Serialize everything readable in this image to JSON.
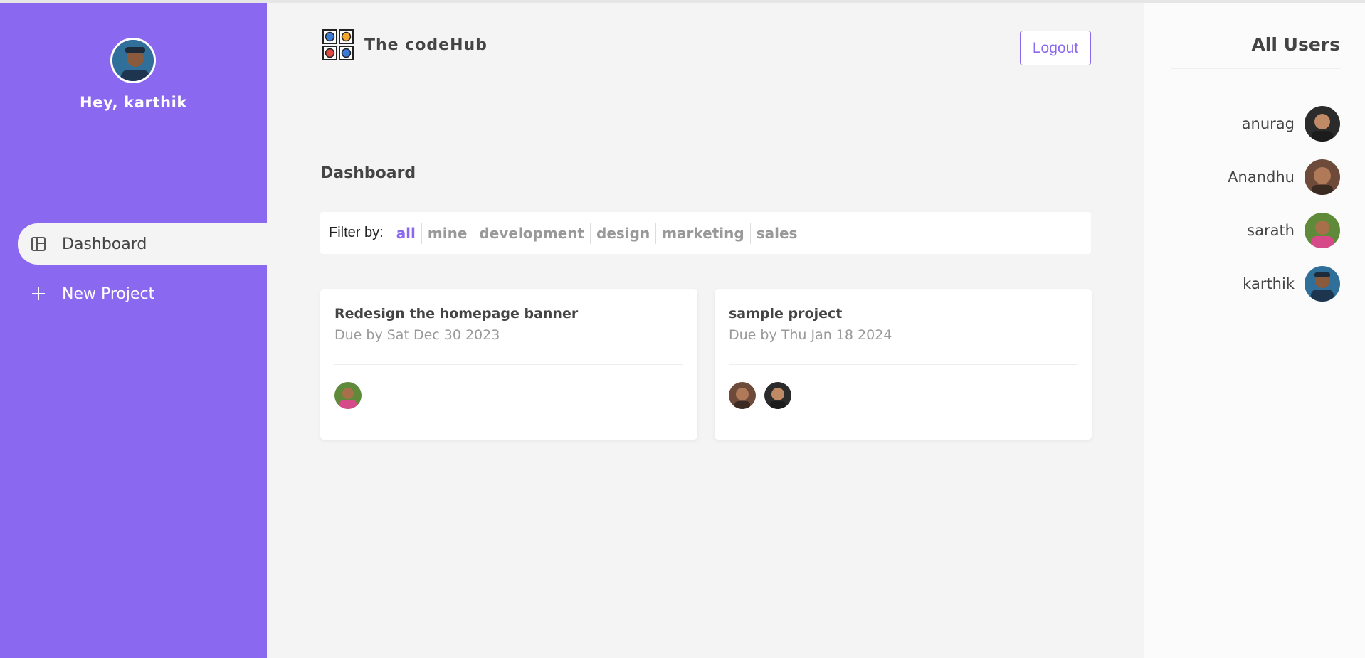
{
  "sidebar": {
    "greeting": "Hey, karthik",
    "nav": [
      {
        "label": "Dashboard",
        "icon": "dashboard-icon",
        "active": true
      },
      {
        "label": "New Project",
        "icon": "plus-icon",
        "active": false
      }
    ]
  },
  "header": {
    "brand_name": "The codeHub",
    "logout_label": "Logout"
  },
  "main": {
    "page_title": "Dashboard",
    "filter": {
      "label": "Filter by:",
      "options": [
        "all",
        "mine",
        "development",
        "design",
        "marketing",
        "sales"
      ],
      "selected": "all"
    },
    "projects": [
      {
        "title": "Redesign the homepage banner",
        "due": "Due by Sat Dec 30 2023"
      },
      {
        "title": "sample project",
        "due": "Due by Thu Jan 18 2024"
      }
    ]
  },
  "users_panel": {
    "title": "All Users",
    "users": [
      "anurag",
      "Anandhu",
      "sarath",
      "karthik"
    ]
  },
  "colors": {
    "accent": "#8b68f0",
    "background": "#f4f4f4",
    "panel": "#fbfbfb"
  }
}
